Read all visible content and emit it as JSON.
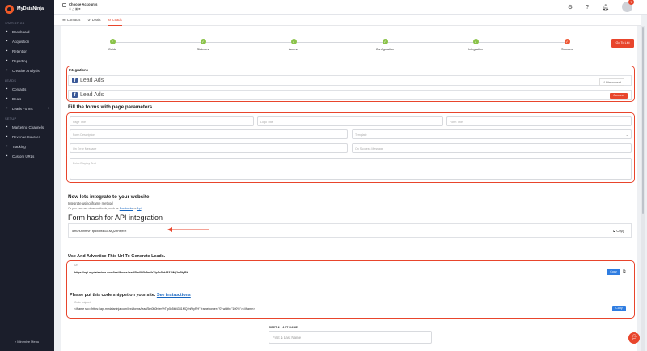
{
  "brand": {
    "name": "MyDataNinja"
  },
  "sidebar": {
    "sections": [
      {
        "title": "STATISTICS",
        "items": [
          {
            "label": "Dashboard",
            "icon": "grid-icon"
          },
          {
            "label": "Acquisition",
            "icon": "trend-icon"
          },
          {
            "label": "Retention",
            "icon": "retention-icon"
          },
          {
            "label": "Reporting",
            "icon": "report-icon"
          },
          {
            "label": "Creative Analysis",
            "icon": "creative-icon"
          }
        ]
      },
      {
        "title": "LEADS",
        "items": [
          {
            "label": "Contacts",
            "icon": "contacts-icon"
          },
          {
            "label": "Deals",
            "icon": "deals-icon"
          },
          {
            "label": "Leads Forms",
            "icon": "forms-icon",
            "chevron": "›"
          }
        ]
      },
      {
        "title": "SETUP",
        "items": [
          {
            "label": "Marketing Channels",
            "icon": "channels-icon"
          },
          {
            "label": "Revenue Sources",
            "icon": "revenue-icon"
          },
          {
            "label": "Tracking",
            "icon": "tracking-icon"
          },
          {
            "label": "Custom URLs",
            "icon": "link-icon"
          }
        ]
      }
    ],
    "minimize_label": "‹ Minimize Menu"
  },
  "topbar": {
    "account_name": "Choose Accounts",
    "account_sub": "⬡ △ ▣ ■",
    "notification_count": "7"
  },
  "tabs": [
    {
      "label": "Contacts",
      "icon": "☰"
    },
    {
      "label": "Deals",
      "icon": "✰"
    },
    {
      "label": "Leads",
      "icon": "☲"
    }
  ],
  "steps": {
    "items": [
      {
        "label": "Guide",
        "mark": "✓"
      },
      {
        "label": "Statuses",
        "mark": "✓"
      },
      {
        "label": "Access",
        "mark": "✓"
      },
      {
        "label": "Configuration",
        "mark": "✓"
      },
      {
        "label": "Integration",
        "mark": "✓"
      },
      {
        "label": "Sources",
        "mark": "✓"
      }
    ],
    "goto_label": "Go To List"
  },
  "integrations": {
    "title": "Integrations",
    "rows": [
      {
        "name": "Lead Ads",
        "action": "Disconnect"
      },
      {
        "name": "Lead Ads",
        "action": "Connect"
      }
    ]
  },
  "params": {
    "title": "Fill the forms with page parameters",
    "placeholders": {
      "page_title": "Page Title",
      "logo_title": "Logo Title",
      "form_title": "Form Title",
      "form_description": "Form Description",
      "template": "Template",
      "success_message": "On Error Message",
      "error_message": "On Success Message",
      "extra_text": "Extra Display Text"
    }
  },
  "integrate": {
    "title": "Now lets integrate to your website",
    "subtitle": "Integrate using iframe method",
    "hint": "Or you can use other methods, such as",
    "hint_link1": "Postbacks",
    "hint_mid": "or",
    "hint_link2": "Api",
    "hash_title": "Form hash for API integration",
    "hash_value": "5m0h0h9mVrTtp5x5bt4331MQ2nRtyRH",
    "copy_label": "Copy"
  },
  "url_section": {
    "title": "Use And Advertise This Url To Generate Leads.",
    "url_label": "Url",
    "url_value": "https://api.mydataninja.com/lext/forms/lead/5m0h0h9mVrTtp5x5bt4331MQ2nRtyRH",
    "copy_btn": "Copy",
    "snippet_title": "Please put this code snippet on your site.",
    "snippet_link": "See instructions",
    "code_label": "Code snippet",
    "code_value": "<iframe src=\"https://api.mydataninja.com/lext/forms/lead/5m0h0h9mVrTtp5x5bt4331MQ2nRtyRH\" frameborder=\"0\" width=\"100%\"></iframe>",
    "code_copy_btn": "Copy"
  },
  "form_preview": {
    "label": "FIRST & LAST NAME",
    "placeholder": "First & Last Name"
  },
  "colors": {
    "accent": "#e8452c",
    "step_done": "#8bc34a",
    "link": "#1565c0",
    "copy_btn": "#2f7de1"
  }
}
